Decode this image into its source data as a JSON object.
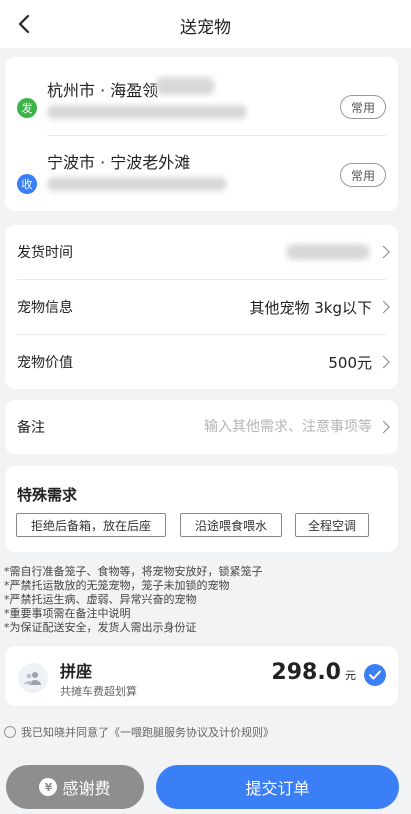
{
  "header": {
    "title": "送宠物",
    "back_icon": "chevron-left-icon"
  },
  "addresses": {
    "from": {
      "badge": "发",
      "badge_color": "#3bb54a",
      "city": "杭州市 · 海盈领",
      "common_label": "常用"
    },
    "to": {
      "badge": "收",
      "badge_color": "#3a7ff6",
      "city": "宁波市 · 宁波老外滩",
      "common_label": "常用"
    }
  },
  "info": {
    "delivery_time": {
      "label": "发货时间",
      "value": ""
    },
    "pet_info": {
      "label": "宠物信息",
      "value": "其他宠物 3kg以下"
    },
    "pet_value": {
      "label": "宠物价值",
      "value": "500元"
    }
  },
  "note": {
    "label": "备注",
    "placeholder": "输入其他需求、注意事项等"
  },
  "special": {
    "title": "特殊需求",
    "tags": [
      "拒绝后备箱，放在后座",
      "沿途喂食喂水",
      "全程空调"
    ]
  },
  "notices": [
    "*需自行准备笼子、食物等，将宠物安放好，锁紧笼子",
    "*严禁托运散放的无笼宠物，笼子未加锁的宠物",
    "*严禁托运生病、虚弱、异常兴奋的宠物",
    "*重要事项需在备注中说明",
    "*为保证配送安全，发货人需出示身份证"
  ],
  "service": {
    "name": "拼座",
    "subtitle": "共摊车费超划算",
    "price": "298.0",
    "unit": "元",
    "icon": "users-icon",
    "check_color": "#3a7ff6"
  },
  "agreement": {
    "text": "我已知晓并同意了《一喂跑腿服务协议及计价规则》"
  },
  "buttons": {
    "thanks_label": "感谢费",
    "thanks_icon": "yen-icon",
    "yen_glyph": "¥",
    "submit_label": "提交订单"
  },
  "colors": {
    "accent": "#3a7ff6",
    "green": "#3bb54a",
    "grey_button": "#8e8e8e"
  }
}
